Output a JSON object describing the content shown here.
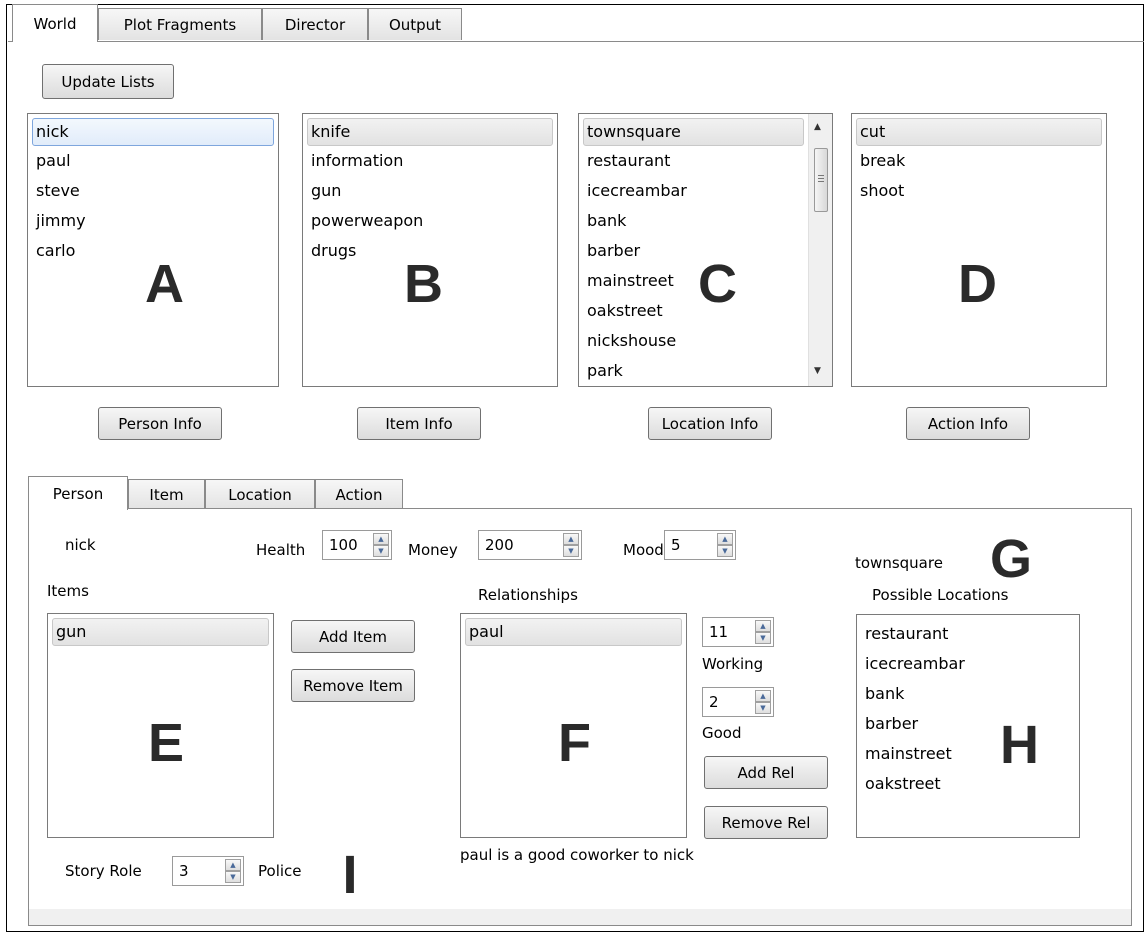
{
  "main_tabs": [
    "World",
    "Plot Fragments",
    "Director",
    "Output"
  ],
  "update_lists_label": "Update Lists",
  "lists": {
    "persons": [
      "nick",
      "paul",
      "steve",
      "jimmy",
      "carlo"
    ],
    "items": [
      "knife",
      "information",
      "gun",
      "powerweapon",
      "drugs"
    ],
    "locations": [
      "townsquare",
      "restaurant",
      "icecreambar",
      "bank",
      "barber",
      "mainstreet",
      "oakstreet",
      "nickshouse",
      "park"
    ],
    "actions": [
      "cut",
      "break",
      "shoot"
    ]
  },
  "info_buttons": {
    "person": "Person Info",
    "item": "Item Info",
    "location": "Location Info",
    "action": "Action Info"
  },
  "big_labels": {
    "a": "A",
    "b": "B",
    "c": "C",
    "d": "D",
    "e": "E",
    "f": "F",
    "g": "G",
    "h": "H",
    "i": "I"
  },
  "sub_tabs": [
    "Person",
    "Item",
    "Location",
    "Action"
  ],
  "person": {
    "name": "nick",
    "health_label": "Health",
    "health": "100",
    "money_label": "Money",
    "money": "200",
    "mood_label": "Mood",
    "mood": "5",
    "location": "townsquare",
    "items_label": "Items",
    "items": [
      "gun"
    ],
    "add_item": "Add Item",
    "remove_item": "Remove Item",
    "relationships_label": "Relationships",
    "relationships": [
      "paul"
    ],
    "rel_type_value": "11",
    "rel_type_label": "Working",
    "rel_quality_value": "2",
    "rel_quality_label": "Good",
    "add_rel": "Add Rel",
    "remove_rel": "Remove Rel",
    "relationship_desc": "paul is a good coworker to nick",
    "possible_locations_label": "Possible Locations",
    "possible_locations": [
      "restaurant",
      "icecreambar",
      "bank",
      "barber",
      "mainstreet",
      "oakstreet"
    ],
    "story_role_label": "Story Role",
    "story_role": "3",
    "story_role_name": "Police"
  }
}
